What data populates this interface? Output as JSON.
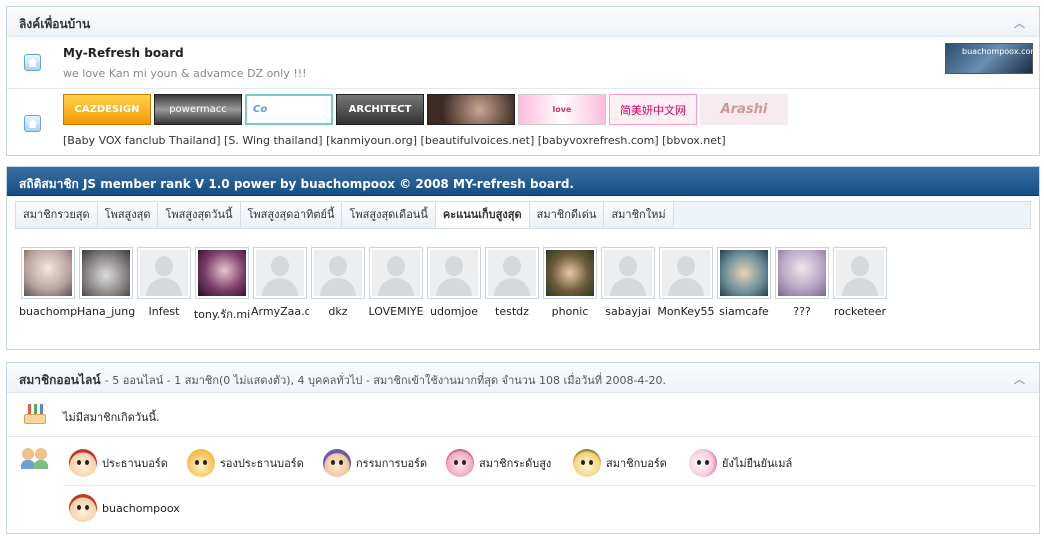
{
  "friends": {
    "title": "ลิงค์เพื่อนบ้าน",
    "site": {
      "name": "My-Refresh board",
      "desc": "we love Kan mi youn & advamce DZ only !!!",
      "banner_text": "buachompoox.com"
    },
    "banners": [
      "CAZDESIGN",
      "powermacc",
      "Co",
      "ARCHITECT",
      "",
      "love",
      "简美妍中文网",
      "Arashi"
    ],
    "links_text": "[Baby VOX fanclub Thailand] [S. Wing thailand] [kanmiyoun.org] [beautifulvoices.net] [babyvoxrefresh.com] [bbvox.net]"
  },
  "ranks": {
    "title": "สถิติสมาชิก JS member rank V 1.0 power by buachompoox © 2008 MY-refresh board.",
    "tabs": [
      "สมาชิกรวยสุด",
      "โพสสูงสุด",
      "โพสสูงสุดวันนี้",
      "โพสสูงสุดอาทิตย์นี้",
      "โพสสูงสุดเดือนนี้",
      "คะแนนเก็บสูงสุด",
      "สมาชิกดีเด่น",
      "สมาชิกใหม่"
    ],
    "active_tab": "คะแนนเก็บสูงสุด",
    "members": [
      "buachompoox",
      "Hana_jung",
      "Infest",
      "tony.รัก.mi",
      "ArmyZaa.c",
      "dkz",
      "LOVEMIYE",
      "udomjoe",
      "testdz",
      "phonic",
      "sabayjai",
      "MonKey55",
      "siamcafe",
      "???",
      "rocketeer"
    ]
  },
  "online": {
    "title": "สมาชิกออนไลน์",
    "stats": "- 5 ออนไลน์ - 1 สมาชิก(0 ไม่แสดงตัว), 4 บุคคลทั่วไป - สมาชิกเข้าใช้งานมากที่สุด จำนวน 108 เมื่อวันที่ 2008-4-20.",
    "birthday_text": "ไม่มีสมาชิกเกิดวันนี้.",
    "legend": [
      "ประธานบอร์ด",
      "รองประธานบอร์ด",
      "กรรมการบอร์ด",
      "สมาชิกระดับสูง",
      "สมาชิกบอร์ด",
      "ยังไม่ยืนยันเมล์"
    ],
    "users": [
      "buachompoox"
    ]
  }
}
